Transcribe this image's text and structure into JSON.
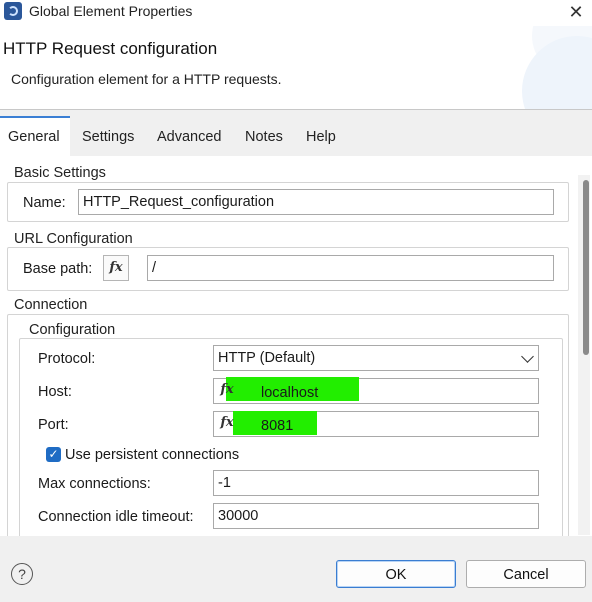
{
  "window": {
    "title": "Global Element Properties",
    "close_glyph": "✕"
  },
  "header": {
    "title": "HTTP Request configuration",
    "description": "Configuration element for a HTTP requests."
  },
  "tabs": [
    {
      "label": "General",
      "active": true
    },
    {
      "label": "Settings"
    },
    {
      "label": "Advanced"
    },
    {
      "label": "Notes"
    },
    {
      "label": "Help"
    }
  ],
  "basic": {
    "legend": "Basic Settings",
    "name_label": "Name:",
    "name_value": "HTTP_Request_configuration"
  },
  "url": {
    "legend": "URL Configuration",
    "base_path_label": "Base path:",
    "base_path_value": "/"
  },
  "connection": {
    "legend": "Connection",
    "configuration_legend": "Configuration",
    "protocol_label": "Protocol:",
    "protocol_value": "HTTP (Default)",
    "host_label": "Host:",
    "host_value": "localhost",
    "port_label": "Port:",
    "port_value": "8081",
    "persistent_label": "Use persistent connections",
    "persistent_checked": true,
    "max_conn_label": "Max connections:",
    "max_conn_value": "-1",
    "idle_timeout_label": "Connection idle timeout:",
    "idle_timeout_value": "30000"
  },
  "fx_glyph": "fx",
  "check_glyph": "✓",
  "footer": {
    "help_glyph": "?",
    "ok_label": "OK",
    "cancel_label": "Cancel"
  },
  "colors": {
    "accent": "#1f6cc4",
    "highlight": "#22ee00"
  }
}
